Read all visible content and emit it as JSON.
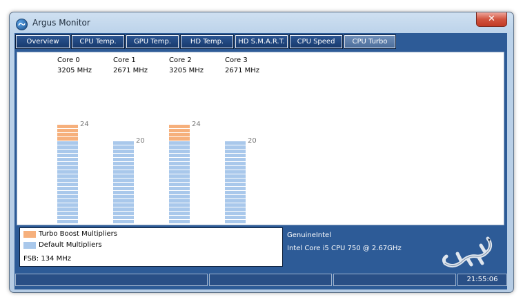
{
  "window": {
    "title": "Argus Monitor",
    "close_glyph": "✕"
  },
  "tabs": [
    {
      "label": "Overview",
      "active": false
    },
    {
      "label": "CPU Temp.",
      "active": false
    },
    {
      "label": "GPU Temp.",
      "active": false
    },
    {
      "label": "HD Temp.",
      "active": false
    },
    {
      "label": "HD S.M.A.R.T.",
      "active": false
    },
    {
      "label": "CPU Speed",
      "active": false
    },
    {
      "label": "CPU Turbo",
      "active": true
    }
  ],
  "cores": [
    {
      "name": "Core 0",
      "speed": "3205 MHz",
      "multiplier": 24,
      "default": 20
    },
    {
      "name": "Core 1",
      "speed": "2671 MHz",
      "multiplier": 20,
      "default": 20
    },
    {
      "name": "Core 2",
      "speed": "3205 MHz",
      "multiplier": 24,
      "default": 20
    },
    {
      "name": "Core 3",
      "speed": "2671 MHz",
      "multiplier": 20,
      "default": 20
    }
  ],
  "legend": {
    "turbo": "Turbo Boost Multipliers",
    "default": "Default Multipliers",
    "fsb": "FSB: 134 MHz",
    "turbo_color": "#f6b07c",
    "default_color": "#a9c8eb"
  },
  "cpu": {
    "vendor": "GenuineIntel",
    "model": "Intel Core i5 CPU 750 @ 2.67GHz"
  },
  "status": {
    "clock": "21:55:06"
  },
  "icons": {
    "app": "argus-logo-icon",
    "mascot": "gecko-logo"
  }
}
